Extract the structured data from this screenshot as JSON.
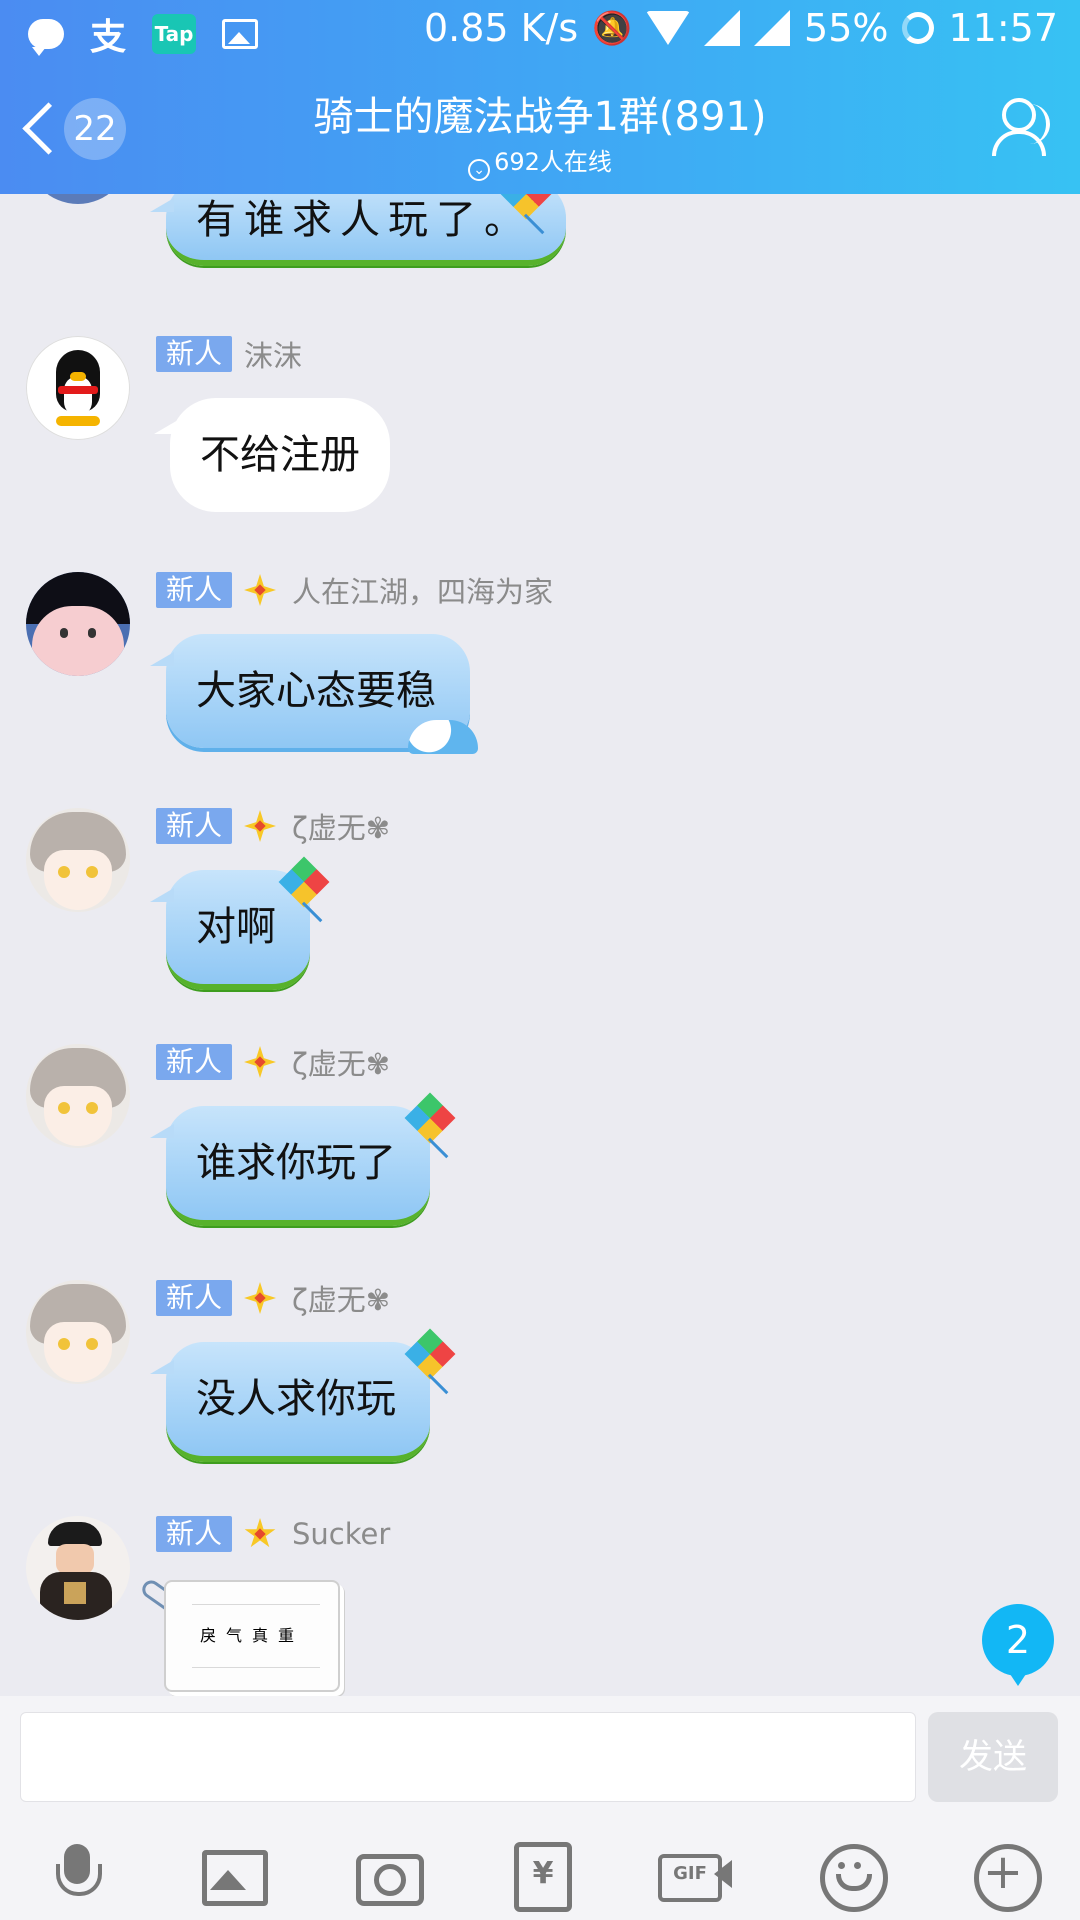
{
  "status_bar": {
    "speed": "0.85 K/s",
    "battery": "55%",
    "time": "11:57",
    "left_icons": [
      "chat-notification-icon",
      "zhi-app-icon",
      "tap-app-icon",
      "image-notification-icon"
    ],
    "zhi_label": "支",
    "tap_label": "Tap",
    "right_icons": [
      "bell-off-icon",
      "wifi-icon",
      "signal-icon",
      "battery-ring-icon"
    ]
  },
  "header": {
    "back_icon": "chevron-left-icon",
    "unread_count": "22",
    "title": "骑士的魔法战争1群(891)",
    "online_text": "692人在线",
    "members_icon": "group-members-icon"
  },
  "messages": [
    {
      "badge": "",
      "name": "",
      "text": "有谁求人玩了。",
      "style": "blue-grass-handwritten"
    },
    {
      "badge": "新人",
      "name": "沫沫",
      "text": "不给注册",
      "style": "white",
      "avatar": "penguin"
    },
    {
      "badge": "新人",
      "name": "人在江湖，四海为家",
      "text": "大家心态要稳",
      "style": "blue-wave",
      "avatar": "cartoon-girl"
    },
    {
      "badge": "新人",
      "name": "ζ虚无✾",
      "text": "对啊",
      "style": "blue-grass-kite",
      "avatar": "anime-girl"
    },
    {
      "badge": "新人",
      "name": "ζ虚无✾",
      "text": "谁求你玩了",
      "style": "blue-grass-kite",
      "avatar": "anime-girl"
    },
    {
      "badge": "新人",
      "name": "ζ虚无✾",
      "text": "没人求你玩",
      "style": "blue-grass-kite",
      "avatar": "anime-girl"
    },
    {
      "badge": "新人",
      "name": "Sucker",
      "text": "戾气真重",
      "style": "note-paper",
      "avatar": "qing-officer"
    }
  ],
  "new_message_count": "2",
  "composer": {
    "input_value": "",
    "send_label": "发送",
    "tools": [
      "microphone-icon",
      "image-icon",
      "camera-icon",
      "red-packet-icon",
      "gif-icon",
      "emoji-icon",
      "plus-icon"
    ]
  },
  "colors": {
    "header_start": "#4b8cf2",
    "header_end": "#37c2f3",
    "badge": "#7aa8ee",
    "background": "#ebebf1",
    "new_message": "#12b7f5"
  }
}
